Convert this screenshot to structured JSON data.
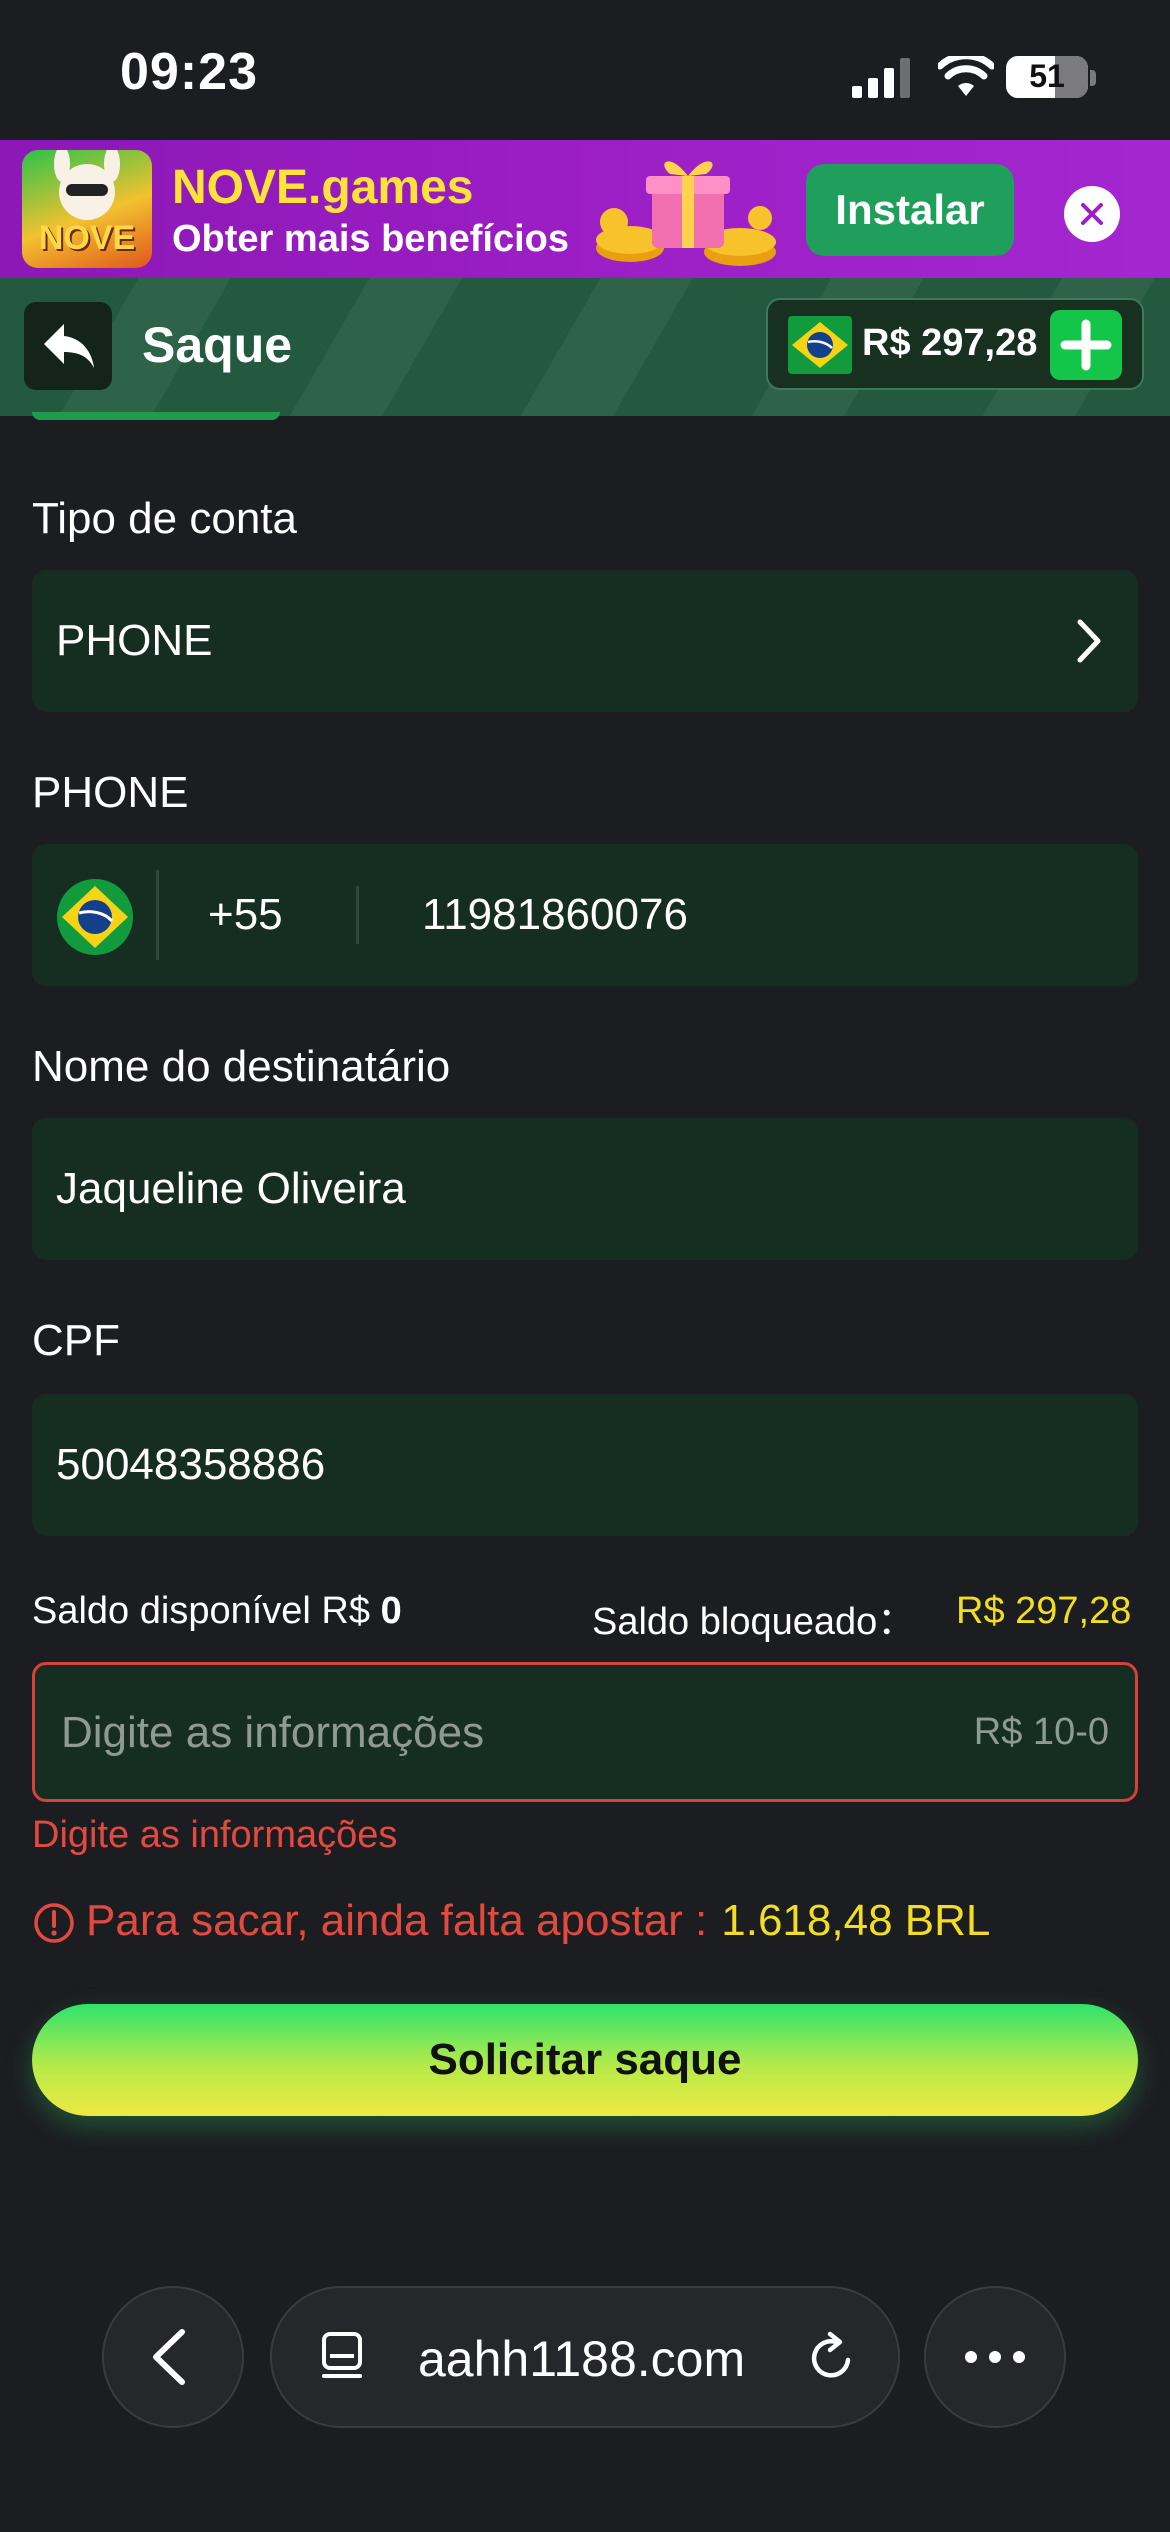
{
  "status_bar": {
    "time": "09:23",
    "battery": "51"
  },
  "banner": {
    "app_logo_text": "NOVE",
    "title": "NOVE.games",
    "subtitle": "Obter mais benefícios",
    "install_label": "Instalar"
  },
  "header": {
    "title": "Saque",
    "balance": "R$ 297,28"
  },
  "form": {
    "account_type": {
      "label": "Tipo de conta",
      "value": "PHONE"
    },
    "phone": {
      "label": "PHONE",
      "country_code": "+55",
      "number": "11981860076"
    },
    "recipient": {
      "label": "Nome do destinatário",
      "value": "Jaqueline Oliveira"
    },
    "cpf": {
      "label": "CPF",
      "value": "50048358886"
    },
    "available_balance": {
      "label": "Saldo disponível R$",
      "value": "0"
    },
    "blocked_balance": {
      "label": "Saldo bloqueado：",
      "value": "R$ 297,28"
    },
    "amount": {
      "placeholder": "Digite as informações",
      "range": "R$ 10-0",
      "error": "Digite as informações"
    },
    "wager_warning": {
      "text": "Para sacar, ainda falta apostar :",
      "value": "1.618,48 BRL"
    },
    "submit_label": "Solicitar saque"
  },
  "browser": {
    "url": "aahh1188.com"
  },
  "colors": {
    "background": "#1c1d21",
    "field": "#162e22",
    "header": "#235a3f",
    "error": "#e34a3f",
    "highlight": "#f1dd25",
    "primary_green": "#13c64a"
  },
  "icons": [
    "signal-icon",
    "wifi-icon",
    "battery-icon",
    "gift-icon",
    "close-icon",
    "back-arrow-icon",
    "brazil-flag-icon",
    "plus-icon",
    "chevron-right-icon",
    "warning-icon",
    "tabs-icon",
    "reload-icon",
    "more-icon",
    "chevron-left-icon"
  ]
}
